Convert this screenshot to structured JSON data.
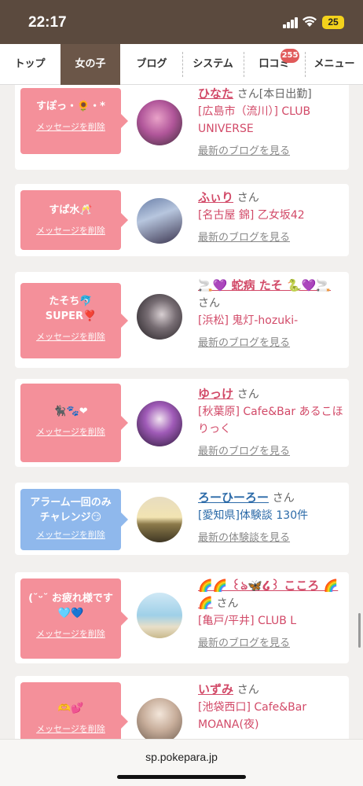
{
  "status": {
    "time": "22:17",
    "battery": "25"
  },
  "tabs": [
    {
      "label": "トップ",
      "active": false
    },
    {
      "label": "女の子",
      "active": true
    },
    {
      "label": "ブログ",
      "active": false
    },
    {
      "label": "システム",
      "active": false
    },
    {
      "label": "口コミ",
      "active": false,
      "badge": "255"
    },
    {
      "label": "メニュー",
      "active": false
    }
  ],
  "cards": [
    {
      "message": "すぽっ・🌻・*",
      "delete_label": "メッセージを削除",
      "name": "ひなた",
      "san": "さん[本日出勤]",
      "shop": "[広島市（流川）] CLUB UNIVERSE",
      "link": "最新のブログを見る",
      "bubble_color": "pink",
      "avatar": "avatar-pink-hair"
    },
    {
      "message": "すぱ水🥂",
      "delete_label": "メッセージを削除",
      "name": "ふぃり",
      "san": "さん",
      "shop": "[名古屋 錦] 乙女坂42",
      "link": "最新のブログを見る",
      "bubble_color": "pink",
      "avatar": "avatar-gothic"
    },
    {
      "message": "たそち🐬 SUPER❣️",
      "delete_label": "メッセージを削除",
      "name": "🚬💜 蛇病 たそ 🐍💜🚬",
      "san": "さん",
      "shop": "[浜松] 鬼灯-hozuki-",
      "link": "最新のブログを見る",
      "bubble_color": "pink",
      "avatar": "avatar-dark"
    },
    {
      "message": "🐈‍⬛🐾❤",
      "delete_label": "メッセージを削除",
      "name": "ゆっけ",
      "san": "さん",
      "shop": "[秋葉原] Cafe&Bar あるこほりっく",
      "link": "最新のブログを見る",
      "bubble_color": "pink",
      "avatar": "avatar-purple"
    },
    {
      "message": "アラーム一回のみチャレンジ😏",
      "delete_label": "メッセージを削除",
      "name": "ろーひーろー",
      "san": "さん",
      "shop": "[愛知県]体験談 130件",
      "link": "最新の体験談を見る",
      "bubble_color": "blue",
      "avatar": "avatar-sunset"
    },
    {
      "message": "(˘ᵕ˘ お疲れ様です🩵💙",
      "delete_label": "メッセージを削除",
      "name": "🌈🌈 ꒰ঌ🦋໒꒱ こころ 🌈🌈",
      "san": "さん",
      "shop": "[亀戸/平井] CLUB L",
      "link": "最新のブログを見る",
      "bubble_color": "pink",
      "avatar": "avatar-beach"
    },
    {
      "message": "🫶💕",
      "delete_label": "メッセージを削除",
      "name": "いずみ",
      "san": "さん",
      "shop": "[池袋西口] Cafe&Bar MOANA(夜)",
      "link": "",
      "bubble_color": "pink",
      "avatar": "avatar-light"
    }
  ],
  "url": "sp.pokepara.jp"
}
